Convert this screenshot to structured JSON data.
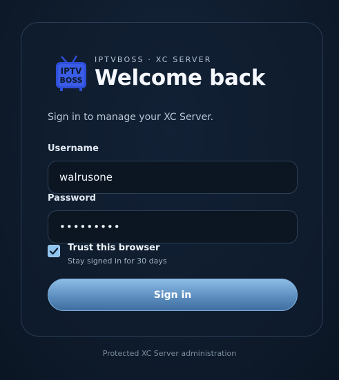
{
  "brand": {
    "logo_text_top": "IPTV",
    "logo_text_bottom": "BOSS",
    "eyebrow": "IPTVBOSS · XC SERVER",
    "title": "Welcome back",
    "subtitle": "Sign in to manage your XC Server."
  },
  "form": {
    "username_label": "Username",
    "username_value": "walrusone",
    "password_label": "Password",
    "password_value": "•••••••••",
    "trust_label": "Trust this browser",
    "trust_hint": "Stay signed in for 30 days",
    "trust_checked": true,
    "submit_label": "Sign in"
  },
  "footer": {
    "text": "Protected XC Server administration"
  },
  "colors": {
    "accent": "#6f9fd1",
    "checkbox": "#8ec3ee",
    "logo": "#2f4fd8"
  },
  "icons": {
    "logo": "iptvboss-tv-logo",
    "check": "checkmark-icon"
  }
}
